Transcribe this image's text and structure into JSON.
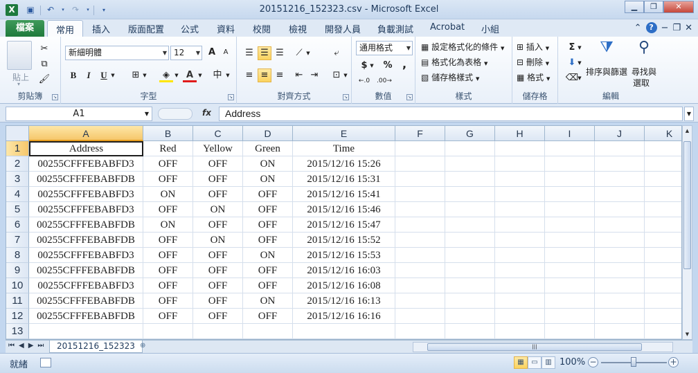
{
  "window": {
    "title": "20151216_152323.csv - Microsoft Excel",
    "logo": "X"
  },
  "qat": {
    "save": "save-icon",
    "undo": "undo-icon",
    "redo": "redo-icon",
    "customize": "customize-icon"
  },
  "window_buttons": {
    "minimize": "▁",
    "restore": "❐",
    "close": "✕"
  },
  "ribbon_tabs": {
    "file": "檔案",
    "items": [
      "常用",
      "插入",
      "版面配置",
      "公式",
      "資料",
      "校閱",
      "檢視",
      "開發人員",
      "負載測試",
      "Acrobat",
      "小組"
    ],
    "active_index": 0
  },
  "ribbon": {
    "clipboard": {
      "label": "剪貼簿",
      "paste": "貼上"
    },
    "font": {
      "label": "字型",
      "name": "新細明體",
      "size": "12",
      "bold": "B",
      "italic": "I",
      "underline": "U",
      "grow": "A",
      "shrink": "A"
    },
    "alignment": {
      "label": "對齊方式"
    },
    "number": {
      "label": "數值",
      "format": "通用格式",
      "currency": "$",
      "percent": "%",
      "comma": ","
    },
    "styles": {
      "label": "樣式",
      "conditional": "設定格式化的條件",
      "as_table": "格式化為表格",
      "cell_styles": "儲存格樣式"
    },
    "cells": {
      "label": "儲存格",
      "insert": "插入",
      "delete": "刪除",
      "format": "格式"
    },
    "editing": {
      "label": "編輯",
      "sort": "排序與篩選",
      "find": "尋找與",
      "select": "選取"
    }
  },
  "formula_bar": {
    "name_box": "A1",
    "fx": "fx",
    "content": "Address"
  },
  "sheet": {
    "columns": [
      "A",
      "B",
      "C",
      "D",
      "E",
      "F",
      "G",
      "H",
      "I",
      "J",
      "K"
    ],
    "row_numbers": [
      "1",
      "2",
      "3",
      "4",
      "5",
      "6",
      "7",
      "8",
      "9",
      "10",
      "11",
      "12",
      "13"
    ],
    "header": [
      "Address",
      "Red",
      "Yellow",
      "Green",
      "Time"
    ],
    "rows": [
      [
        "00255CFFFEBABFD3",
        "OFF",
        "OFF",
        "ON",
        "2015/12/16 15:26"
      ],
      [
        "00255CFFFEBABFDB",
        "OFF",
        "OFF",
        "ON",
        "2015/12/16 15:31"
      ],
      [
        "00255CFFFEBABFD3",
        "ON",
        "OFF",
        "OFF",
        "2015/12/16 15:41"
      ],
      [
        "00255CFFFEBABFD3",
        "OFF",
        "ON",
        "OFF",
        "2015/12/16 15:46"
      ],
      [
        "00255CFFFEBABFDB",
        "ON",
        "OFF",
        "OFF",
        "2015/12/16 15:47"
      ],
      [
        "00255CFFFEBABFDB",
        "OFF",
        "ON",
        "OFF",
        "2015/12/16 15:52"
      ],
      [
        "00255CFFFEBABFD3",
        "OFF",
        "OFF",
        "ON",
        "2015/12/16 15:53"
      ],
      [
        "00255CFFFEBABFDB",
        "OFF",
        "OFF",
        "OFF",
        "2015/12/16 16:03"
      ],
      [
        "00255CFFFEBABFD3",
        "OFF",
        "OFF",
        "OFF",
        "2015/12/16 16:08"
      ],
      [
        "00255CFFFEBABFDB",
        "OFF",
        "OFF",
        "ON",
        "2015/12/16 16:13"
      ],
      [
        "00255CFFFEBABFDB",
        "OFF",
        "OFF",
        "OFF",
        "2015/12/16 16:16"
      ]
    ],
    "active_cell": "A1",
    "tab_name": "20151216_152323"
  },
  "status": {
    "ready": "就緒",
    "zoom": "100%",
    "zoom_out": "−",
    "zoom_in": "+"
  },
  "colors": {
    "file_tab": "#1f7a3c",
    "selection": "#f6c76b",
    "grid": "#d5dfec"
  }
}
